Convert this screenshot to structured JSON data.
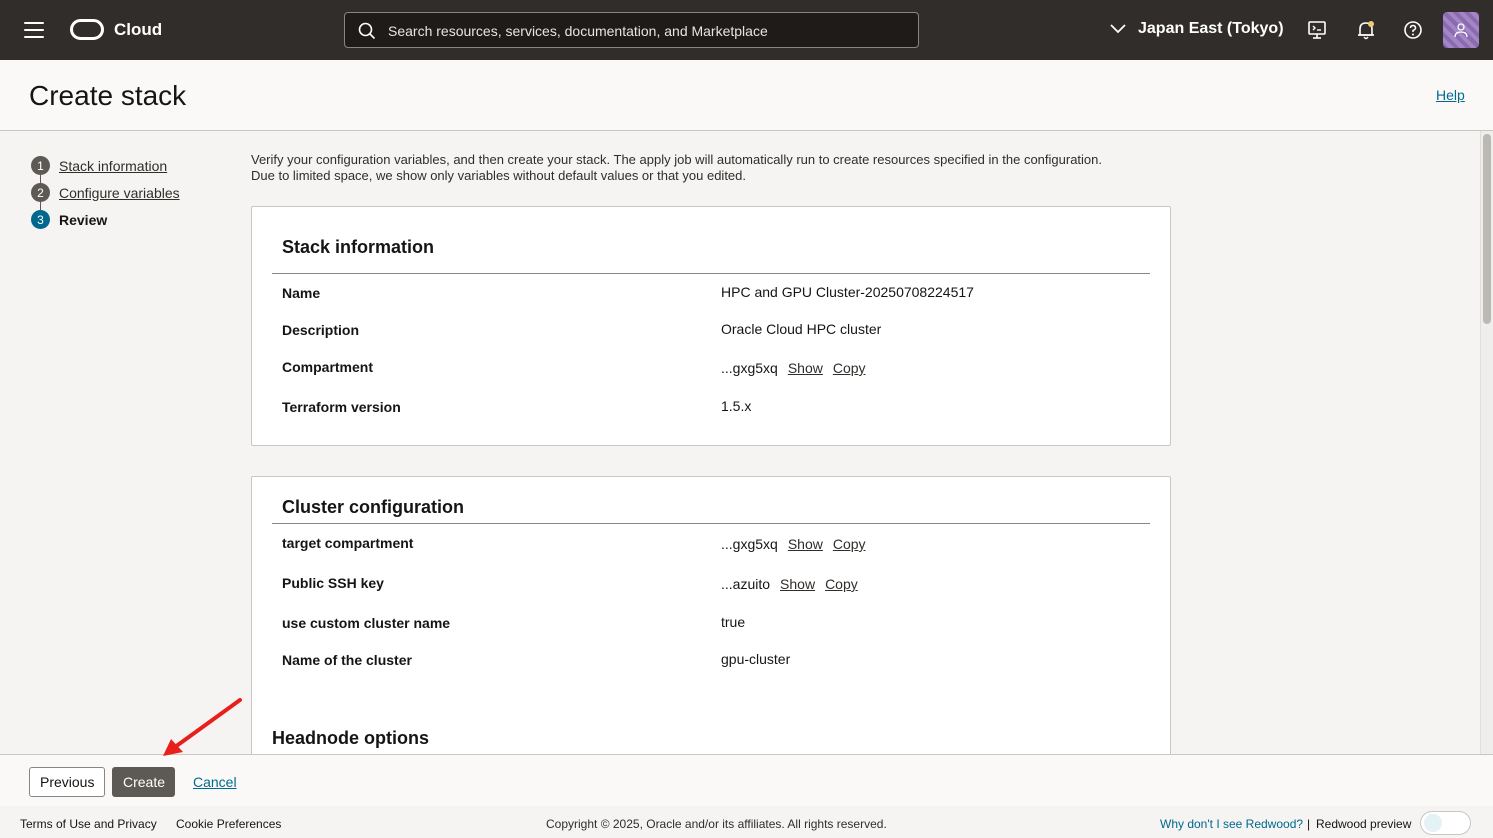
{
  "topbar": {
    "brand": "Cloud",
    "search_placeholder": "Search resources, services, documentation, and Marketplace",
    "region": "Japan East (Tokyo)",
    "icons": [
      "menu-icon",
      "search-icon",
      "chevron-down-icon",
      "cloud-shell-icon",
      "bell-icon",
      "help-icon",
      "user-icon"
    ]
  },
  "header": {
    "title": "Create stack",
    "help": "Help"
  },
  "steps": [
    {
      "num": "1",
      "label": "Stack information"
    },
    {
      "num": "2",
      "label": "Configure variables"
    },
    {
      "num": "3",
      "label": "Review"
    }
  ],
  "intro": "Verify your configuration variables, and then create your stack. The apply job will automatically run to create resources specified in the configuration. Due to limited space, we show only variables without default values or that you edited.",
  "stack_info": {
    "title": "Stack information",
    "name_label": "Name",
    "name_value": "HPC and GPU Cluster-20250708224517",
    "desc_label": "Description",
    "desc_value": "Oracle Cloud HPC cluster",
    "comp_label": "Compartment",
    "comp_value": "...gxg5xq",
    "tf_label": "Terraform version",
    "tf_value": "1.5.x"
  },
  "cluster_config": {
    "title": "Cluster configuration",
    "target_label": "target compartment",
    "target_value": "...gxg5xq",
    "ssh_label": "Public SSH key",
    "ssh_value": "...azuito",
    "custom_label": "use custom cluster name",
    "custom_value": "true",
    "name_label": "Name of the cluster",
    "name_value": "gpu-cluster"
  },
  "headnode": {
    "title": "Headnode options"
  },
  "links": {
    "show": "Show",
    "copy": "Copy"
  },
  "actions": {
    "previous": "Previous",
    "create": "Create",
    "cancel": "Cancel"
  },
  "footer": {
    "terms": "Terms of Use and Privacy",
    "cookies": "Cookie Preferences",
    "copyright": "Copyright © 2025, Oracle and/or its affiliates. All rights reserved.",
    "redwood_q": "Why don't I see Redwood?",
    "separator": "|",
    "redwood_preview": "Redwood preview"
  },
  "colors": {
    "topbar": "#312d2a",
    "link": "#006b8f",
    "active_step": "#00688c",
    "create_button": "#5d5955",
    "annotation_arrow": "#e8201c"
  }
}
